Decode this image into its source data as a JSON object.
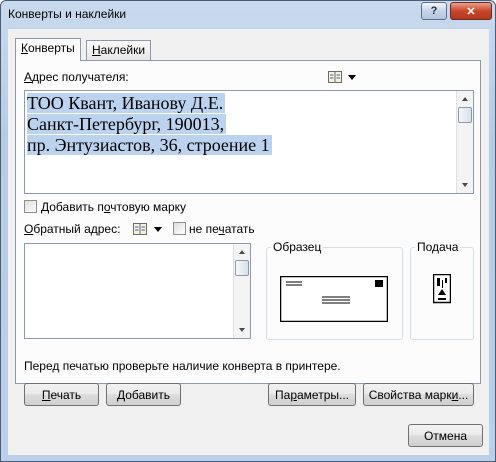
{
  "window": {
    "title": "Конверты и наклейки",
    "help": "?",
    "close": "✕"
  },
  "tabs": [
    {
      "label": "Конверты"
    },
    {
      "label": "Наклейки"
    }
  ],
  "recipient": {
    "label": "Адрес получателя:",
    "lines": [
      "ТОО Квант, Иванову Д.Е.",
      "Санкт-Петербург, 190013,",
      "пр. Энтузиастов, 36, строение 1"
    ]
  },
  "add_stamp": {
    "label": "Добавить почтовую марку",
    "checked": false
  },
  "return_address": {
    "label": "Обратный адрес:",
    "value": "",
    "omit_label": "не печатать",
    "omit_checked": false
  },
  "preview": {
    "label": "Образец"
  },
  "feed": {
    "label": "Подача"
  },
  "hint": "Перед печатью проверьте наличие конверта в принтере.",
  "buttons": {
    "print": "Печать",
    "add": "Добавить",
    "options": "Параметры...",
    "stamp_props": "Свойства марки...",
    "cancel": "Отмена"
  },
  "icons": {
    "address_book": "address-book-icon",
    "dropdown": "dropdown-arrow-icon"
  }
}
